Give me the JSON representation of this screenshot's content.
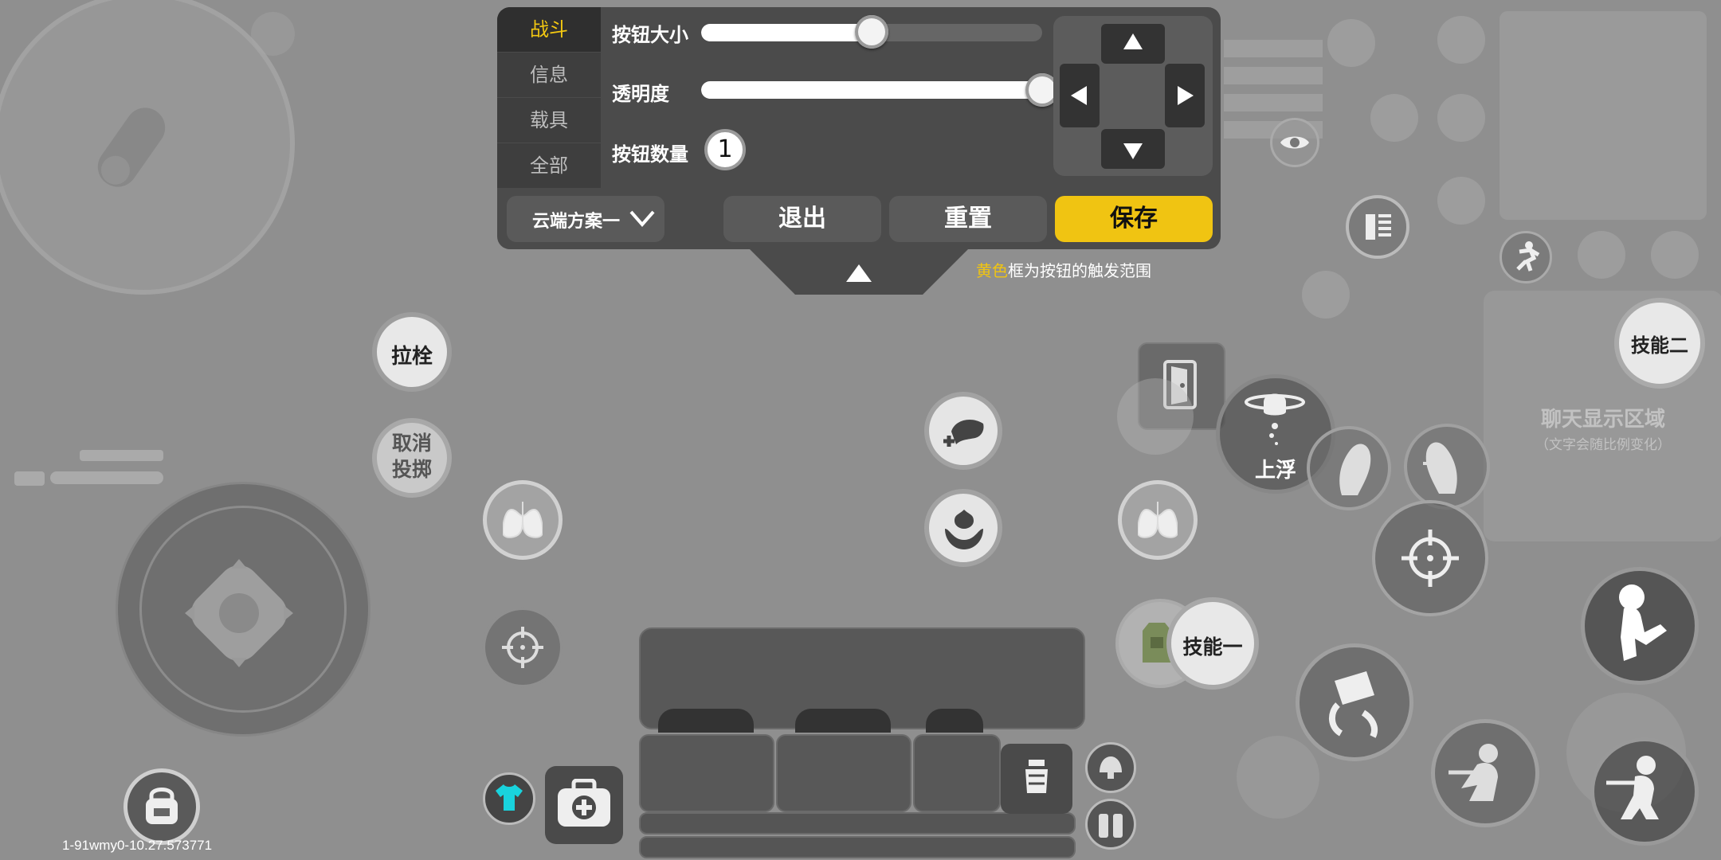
{
  "settings_panel": {
    "tabs": [
      {
        "label": "战斗",
        "active": true
      },
      {
        "label": "信息",
        "active": false
      },
      {
        "label": "载具",
        "active": false
      },
      {
        "label": "全部",
        "active": false
      }
    ],
    "button_size": {
      "label": "按钮大小",
      "value": 0.5
    },
    "opacity": {
      "label": "透明度",
      "value": 1.0
    },
    "button_count": {
      "label": "按钮数量",
      "value": "1"
    },
    "scheme_select": {
      "value": "云端方案一"
    },
    "exit_label": "退出",
    "reset_label": "重置",
    "save_label": "保存",
    "hint_highlight": "黄色",
    "hint_rest": "框为按钮的触发范围",
    "accent_color": "#f0c412"
  },
  "hud": {
    "bolt_label": "拉栓",
    "cancel_throw_label": "取消投掷",
    "float_up_label": "上浮",
    "skill_one_label": "技能一",
    "skill_two_label": "技能二",
    "chat_area_title": "聊天显示区域",
    "chat_area_subtitle": "（文字会随比例变化）",
    "build_info": "1-91wmy0-10.27.573771"
  }
}
